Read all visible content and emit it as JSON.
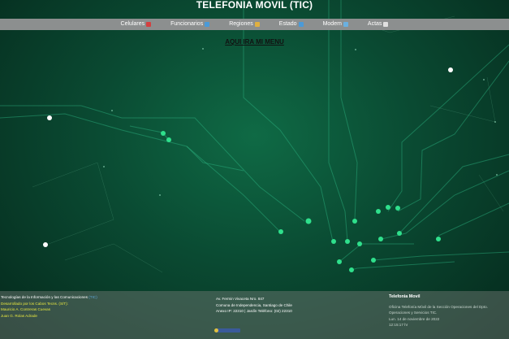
{
  "header": {
    "title": "TELEFONIA MOVIL (TIC)"
  },
  "nav": {
    "items": [
      {
        "label": "Celulares",
        "icon": "phone-icon",
        "color": "#d44040"
      },
      {
        "label": "Funcionarios",
        "icon": "person-icon",
        "color": "#4a9ad8"
      },
      {
        "label": "Regiones",
        "icon": "map-icon",
        "color": "#e0b040"
      },
      {
        "label": "Estado",
        "icon": "status-icon",
        "color": "#4a9ad8"
      },
      {
        "label": "Modem",
        "icon": "chart-icon",
        "color": "#6ab0e0"
      },
      {
        "label": "Actas",
        "icon": "document-icon",
        "color": "#e0e0e0"
      }
    ]
  },
  "main": {
    "menu_text": "AQUI IRA MI MENU"
  },
  "footer": {
    "left": {
      "line1_prefix": "Tecnologías de la Información y las Comunicaciones",
      "line1_tic": "(TIC)",
      "line2": "Desarrollado por los Cabos Tecns. (S/T):",
      "line3": "Mauricio A. Contreras Cuevas",
      "line4": "Juan G. Rolas Adrade"
    },
    "middle": {
      "line1": "Av. Fermin Vivaceta Nro. 847",
      "line2": "Comuna de Independencia, Santiago de Chile",
      "line3": "Anexo IP: 22310 | Jardín Teléfono: (02) 22310"
    },
    "right": {
      "head": "Telefonia Movil",
      "line1": "Oficina Telefonía Móvil de la Sección Operaciones del Dpto.",
      "line2": "Operaciones y Servicios TIC.",
      "line3": "Lun. 14 de noviembre de 2022",
      "line4": "12:15:17 hr"
    }
  }
}
